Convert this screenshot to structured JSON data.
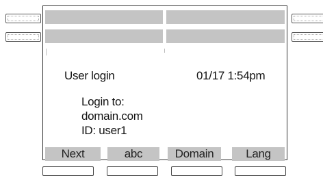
{
  "header": {
    "title": "User login",
    "datetime": "01/17 1:54pm"
  },
  "login": {
    "line1": "Login to:",
    "domain": "domain.com",
    "id_line": "ID: user1"
  },
  "softkeys": [
    {
      "label": "Next"
    },
    {
      "label": "abc"
    },
    {
      "label": "Domain"
    },
    {
      "label": "Lang"
    }
  ]
}
